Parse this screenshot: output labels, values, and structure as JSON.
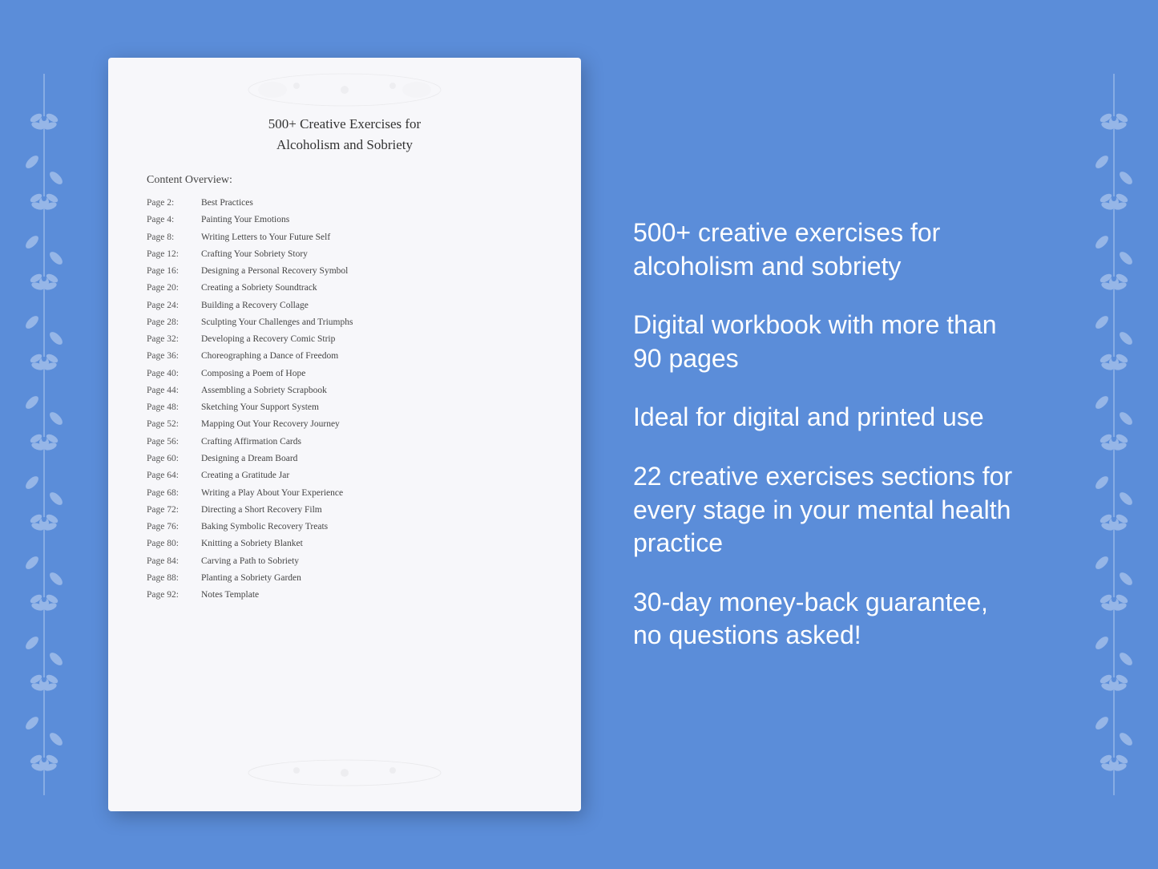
{
  "document": {
    "title_line1": "500+ Creative Exercises for",
    "title_line2": "Alcoholism and Sobriety",
    "content_overview_label": "Content Overview:",
    "toc": [
      {
        "page": "Page  2:",
        "title": "Best Practices"
      },
      {
        "page": "Page  4:",
        "title": "Painting Your Emotions"
      },
      {
        "page": "Page  8:",
        "title": "Writing Letters to Your Future Self"
      },
      {
        "page": "Page 12:",
        "title": "Crafting Your Sobriety Story"
      },
      {
        "page": "Page 16:",
        "title": "Designing a Personal Recovery Symbol"
      },
      {
        "page": "Page 20:",
        "title": "Creating a Sobriety Soundtrack"
      },
      {
        "page": "Page 24:",
        "title": "Building a Recovery Collage"
      },
      {
        "page": "Page 28:",
        "title": "Sculpting Your Challenges and Triumphs"
      },
      {
        "page": "Page 32:",
        "title": "Developing a Recovery Comic Strip"
      },
      {
        "page": "Page 36:",
        "title": "Choreographing a Dance of Freedom"
      },
      {
        "page": "Page 40:",
        "title": "Composing a Poem of Hope"
      },
      {
        "page": "Page 44:",
        "title": "Assembling a Sobriety Scrapbook"
      },
      {
        "page": "Page 48:",
        "title": "Sketching Your Support System"
      },
      {
        "page": "Page 52:",
        "title": "Mapping Out Your Recovery Journey"
      },
      {
        "page": "Page 56:",
        "title": "Crafting Affirmation Cards"
      },
      {
        "page": "Page 60:",
        "title": "Designing a Dream Board"
      },
      {
        "page": "Page 64:",
        "title": "Creating a Gratitude Jar"
      },
      {
        "page": "Page 68:",
        "title": "Writing a Play About Your Experience"
      },
      {
        "page": "Page 72:",
        "title": "Directing a Short Recovery Film"
      },
      {
        "page": "Page 76:",
        "title": "Baking Symbolic Recovery Treats"
      },
      {
        "page": "Page 80:",
        "title": "Knitting a Sobriety Blanket"
      },
      {
        "page": "Page 84:",
        "title": "Carving a Path to Sobriety"
      },
      {
        "page": "Page 88:",
        "title": "Planting a Sobriety Garden"
      },
      {
        "page": "Page 92:",
        "title": "Notes Template"
      }
    ]
  },
  "features": [
    {
      "text": "500+ creative exercises for alcoholism and sobriety"
    },
    {
      "text": "Digital workbook with more than 90 pages"
    },
    {
      "text": "Ideal for digital and printed use"
    },
    {
      "text": "22 creative exercises sections for every stage in your mental health practice"
    },
    {
      "text": "30-day money-back guarantee, no questions asked!"
    }
  ]
}
